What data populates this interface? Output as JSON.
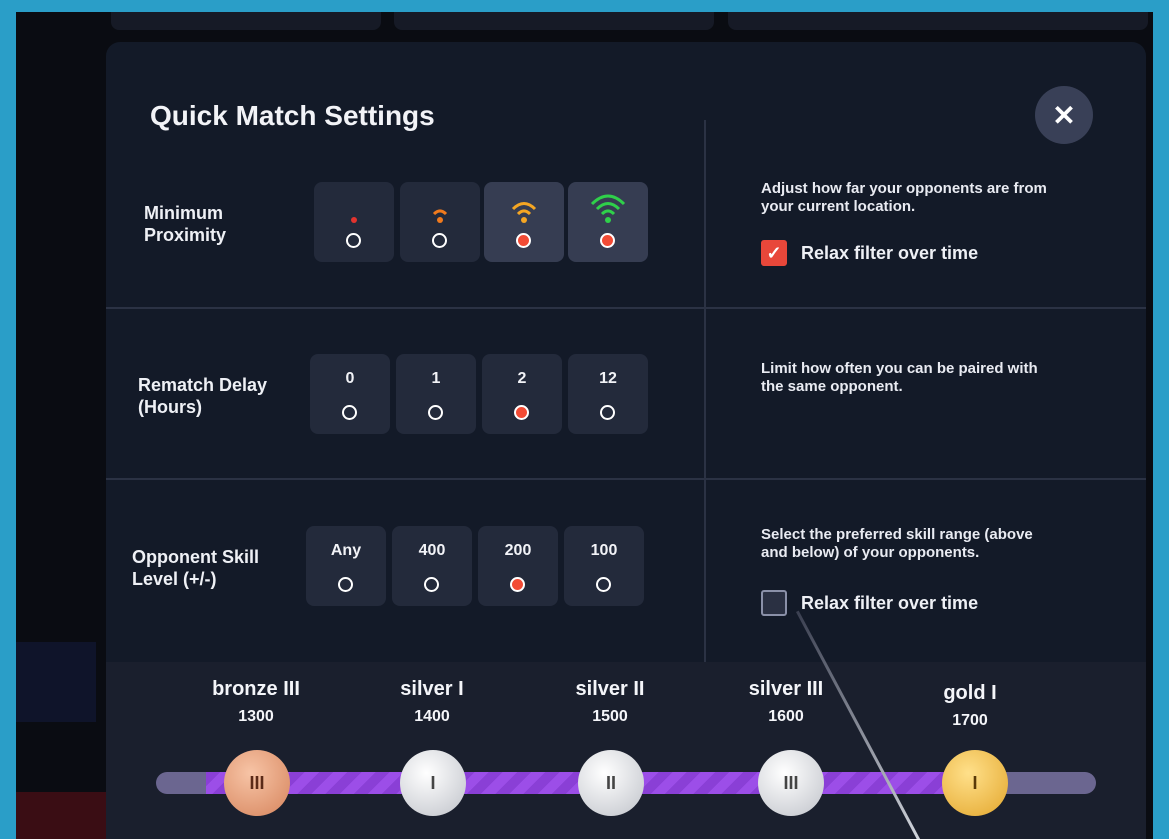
{
  "dialog": {
    "title": "Quick Match Settings",
    "close_label": "✕"
  },
  "proximity": {
    "label_line1": "Minimum",
    "label_line2": "Proximity",
    "options": [
      {
        "icon": "signal-1-icon",
        "color": "#e2332e",
        "selected": false
      },
      {
        "icon": "signal-2-icon",
        "color": "#f07a1d",
        "selected": false
      },
      {
        "icon": "signal-3-icon",
        "color": "#f5a623",
        "selected": true
      },
      {
        "icon": "signal-4-icon",
        "color": "#2fd04a",
        "selected": true
      }
    ],
    "description_line1": "Adjust how far your opponents are from",
    "description_line2": "your current location.",
    "relax_label": "Relax filter over time",
    "relax_checked": true
  },
  "rematch": {
    "label_line1": "Rematch Delay",
    "label_line2": "(Hours)",
    "options": [
      {
        "label": "0",
        "selected": false
      },
      {
        "label": "1",
        "selected": false
      },
      {
        "label": "2",
        "selected": true
      },
      {
        "label": "12",
        "selected": false
      }
    ],
    "description_line1": "Limit how often you can be paired with",
    "description_line2": "the same opponent."
  },
  "skill": {
    "label_line1": "Opponent Skill",
    "label_line2": "Level (+/-)",
    "options": [
      {
        "label": "Any",
        "selected": false
      },
      {
        "label": "400",
        "selected": false
      },
      {
        "label": "200",
        "selected": true
      },
      {
        "label": "100",
        "selected": false
      }
    ],
    "description_line1": "Select the preferred skill range (above",
    "description_line2": "and below) of your opponents.",
    "relax_label": "Relax filter over time",
    "relax_checked": false
  },
  "ranks": [
    {
      "name": "bronze III",
      "score": "1300",
      "medal": "III",
      "tier": "bronze"
    },
    {
      "name": "silver I",
      "score": "1400",
      "medal": "I",
      "tier": "silver"
    },
    {
      "name": "silver II",
      "score": "1500",
      "medal": "II",
      "tier": "silver"
    },
    {
      "name": "silver III",
      "score": "1600",
      "medal": "III",
      "tier": "silver"
    },
    {
      "name": "gold I",
      "score": "1700",
      "medal": "I",
      "tier": "gold"
    }
  ],
  "colors": {
    "accent": "#f24b35",
    "range_fill": "#8a3fd6"
  }
}
